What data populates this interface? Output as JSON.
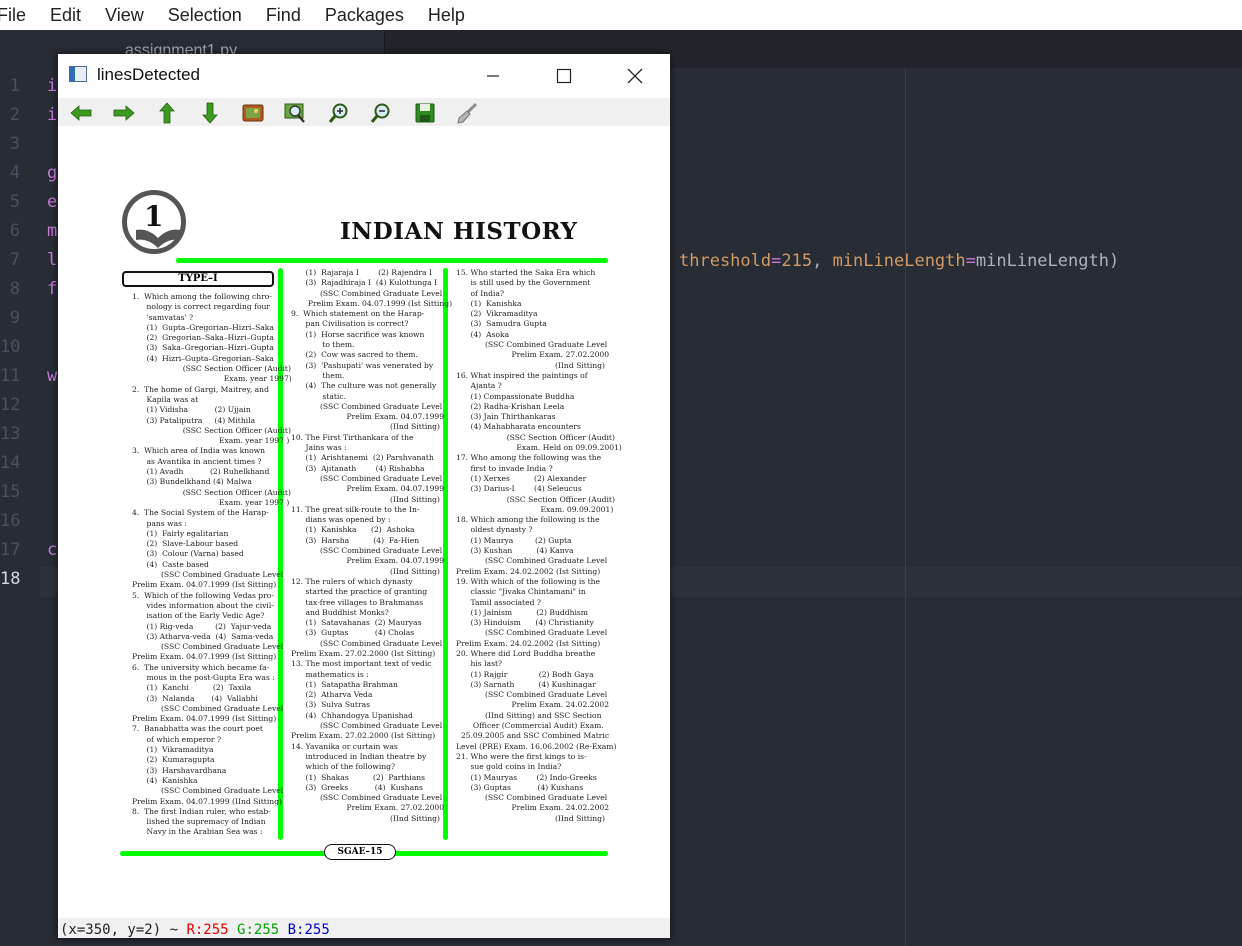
{
  "menubar": {
    "items": [
      "File",
      "Edit",
      "View",
      "Selection",
      "Find",
      "Packages",
      "Help"
    ]
  },
  "editor": {
    "tab_label": "assignment1.py",
    "line_numbers": [
      "1",
      "2",
      "3",
      "4",
      "5",
      "6",
      "7",
      "8",
      "9",
      "10",
      "11",
      "12",
      "13",
      "14",
      "15",
      "16",
      "17",
      "18"
    ],
    "current_line": "18",
    "code_prefixes": [
      "i",
      "i",
      "",
      "g",
      "e",
      "m",
      "l",
      "f",
      "",
      "",
      "w",
      "",
      "",
      "",
      "",
      "",
      "c",
      ""
    ],
    "line7_tail": {
      "p1": "threshold",
      "eq1": "=",
      "v1": "215",
      "sep": ", ",
      "p2": "minLineLength",
      "eq2": "=",
      "v2": "minLineLength)"
    }
  },
  "image_window": {
    "title": "linesDetected",
    "toolbar_icons": [
      "arrow-left-icon",
      "arrow-right-icon",
      "arrow-up-icon",
      "arrow-down-icon",
      "image-icon",
      "zoom-fit-icon",
      "zoom-in-icon",
      "zoom-out-icon",
      "save-icon",
      "brush-icon"
    ],
    "status": {
      "coords": "(x=350, y=2) ~ ",
      "r": "R:255",
      "g": "G:255",
      "b": "B:255"
    },
    "page": {
      "chapter_number": "1",
      "title": "INDIAN HISTORY",
      "type_label": "TYPE–I",
      "footer": "SGAE–15",
      "col1": "1.  Which among the following chro-\n      nology is correct regarding four\n      'samvatas' ?\n      (1)  Gupta–Gregorian–Hizri–Saka\n      (2)  Gregorian–Saka–Hizri–Gupta\n      (3)  Saka–Gregorian–Hizri–Gupta\n      (4)  Hizri–Gupta–Gregorian–Saka\n                     (SSC Section Officer (Audit)\n                                      Exam. year 1997)\n2.  The home of Gargi, Maitrey, and\n      Kapila was at\n      (1) Vidisha           (2) Ujjain\n      (3) Pataliputra     (4) Mithila\n                     (SSC Section Officer (Audit)\n                                    Exam. year 1997 )\n3.  Which area of India was known\n      as Avantika in ancient times ?\n      (1) Avadh           (2) Ruhelkhand\n      (3) Bundelkhand (4) Malwa\n                     (SSC Section Officer (Audit)\n                                    Exam. year 1997 )\n4.  The Social System of the Harap-\n      pans was :\n      (1)  Fairly egalitarian\n      (2)  Slave-Labour based\n      (3)  Colour (Varna) based\n      (4)  Caste based\n            (SSC Combined Graduate Level\nPrelim Exam. 04.07.1999 (Ist Sitting)\n5.  Which of the following Vedas pro-\n      vides information about the civil-\n      isation of the Early Vedic Age?\n      (1) Rig-veda         (2)  Yajur-veda\n      (3) Atharva-veda  (4)  Sama-veda\n            (SSC Combined Graduate Level\nPrelim Exam. 04.07.1999 (Ist Sitting)\n6.  The university which became fa-\n      mous in the post-Gupta Era was :\n      (1)  Kanchi          (2)  Taxila\n      (3)  Nalanda       (4)  Vallabhi\n            (SSC Combined Graduate Level\nPrelim Exam. 04.07.1999 (Ist Sitting)\n7.  Banabhatta was the court poet\n      of which emperor ?\n      (1)  Vikramaditya\n      (2)  Kumaragupta\n      (3)  Harshavardhana\n      (4)  Kanishka\n            (SSC Combined Graduate Level\nPrelim Exam. 04.07.1999 (IInd Sitting)\n8.  The first Indian ruler, who estab-\n      lished the supremacy of Indian\n      Navy in the Arabian Sea was :",
      "col2": "      (1)  Rajaraja I        (2) Rajendra I\n      (3)  Rajadhiraja I  (4) Kulottunga I\n            (SSC Combined Graduate Level\n       Prelim Exam. 04.07.1999 (Ist Sitting)\n9.  Which statement on the Harap-\n      pan Civilisation is correct?\n      (1)  Horse sacrifice was known\n             to them.\n      (2)  Cow was sacred to them.\n      (3)  'Pashupati' was venerated by\n             them.\n      (4)  The culture was not generally\n             static.\n            (SSC Combined Graduate Level\n                       Prelim Exam. 04.07.1999\n                                         (IInd Sitting)\n10. The First Tirthankara of the\n      Jains was :\n      (1)  Arishtanemi  (2) Parshvanath\n      (3)  Ajitanath        (4) Rishabha\n            (SSC Combined Graduate Level\n                       Prelim Exam. 04.07.1999\n                                         (IInd Sitting)\n11. The great silk-route to the In-\n      dians was opened by :\n      (1)  Kanishka      (2)  Ashoka\n      (3)  Harsha          (4)  Fa-Hien\n            (SSC Combined Graduate Level\n                       Prelim Exam. 04.07.1999\n                                         (IInd Sitting)\n12. The rulers of which dynasty\n      started the practice of granting\n      tax-free villages to Brahmanas\n      and Buddhist Monks?\n      (1)  Satavahanas  (2) Mauryas\n      (3)  Guptas           (4) Cholas\n            (SSC Combined Graduate Level\nPrelim Exam. 27.02.2000 (Ist Sitting)\n13. The most important text of vedic\n      mathematics is :\n      (1)  Satapatha Brahman\n      (2)  Atharva Veda\n      (3)  Sulva Sutras\n      (4)  Chhandogya Upanishad\n            (SSC Combined Graduate Level\nPrelim Exam. 27.02.2000 (Ist Sitting)\n14. Yavanika or curtain was\n      introduced in Indian theatre by\n      which of the following?\n      (1)  Shakas          (2)  Parthians\n      (3)  Greeks           (4)  Kushans\n            (SSC Combined Graduate Level\n                       Prelim Exam. 27.02.2000\n                                         (IInd Sitting)",
      "col3": "15. Who started the Saka Era which\n      is still used by the Government\n      of India?\n      (1)  Kanishka\n      (2)  Vikramaditya\n      (3)  Samudra Gupta\n      (4)  Asoka\n            (SSC Combined Graduate Level\n                       Prelim Exam. 27.02.2000\n                                         (IInd Sitting)\n16. What inspired the paintings of\n      Ajanta ?\n      (1) Compassionate Buddha\n      (2) Radha-Krishan Leela\n      (3) Jain Thirthankaras\n      (4) Mahabharata encounters\n                     (SSC Section Officer (Audit)\n                         Exam. Held on 09.09.2001)\n17. Who among the following was the\n      first to invade India ?\n      (1) Xerxes          (2) Alexander\n      (3) Darius-I        (4) Seleucus\n                     (SSC Section Officer (Audit)\n                                   Exam. 09.09.2001)\n18. Which among the following is the\n      oldest dynasty ?\n      (1) Maurya         (2) Gupta\n      (3) Kushan          (4) Kanva\n            (SSC Combined Graduate Level\nPrelim Exam. 24.02.2002 (Ist Sitting)\n19. With which of the following is the\n      classic \"Jivaka Chintamani\" in\n      Tamil associated ?\n      (1) Jainism          (2) Buddhism\n      (3) Hinduism      (4) Christianity\n            (SSC Combined Graduate Level\nPrelim Exam. 24.02.2002 (Ist Sitting)\n20. Where did Lord Buddha breathe\n      his last?\n      (1) Rajgir             (2) Bodh Gaya\n      (3) Sarnath          (4) Kushinagar\n            (SSC Combined Graduate Level\n                       Prelim Exam. 24.02.2002\n            (IInd Sitting) and SSC Section\n       Officer (Commercial Audit) Exam.\n  25.09.2005 and SSC Combined Matric\nLevel (PRE) Exam. 16.06.2002 (Re-Exam)\n21. Who were the first kings to is-\n      sue gold coins in India?\n      (1) Mauryas        (2) Indo-Greeks\n      (3) Guptas           (4) Kushans\n            (SSC Combined Graduate Level\n                       Prelim Exam. 24.02.2002\n                                         (IInd Sitting)"
    }
  },
  "colors": {
    "editor_bg": "#282c34",
    "detected_line": "#00ff00",
    "status_r": "#e00000",
    "status_g": "#00a000",
    "status_b": "#0000d0"
  }
}
